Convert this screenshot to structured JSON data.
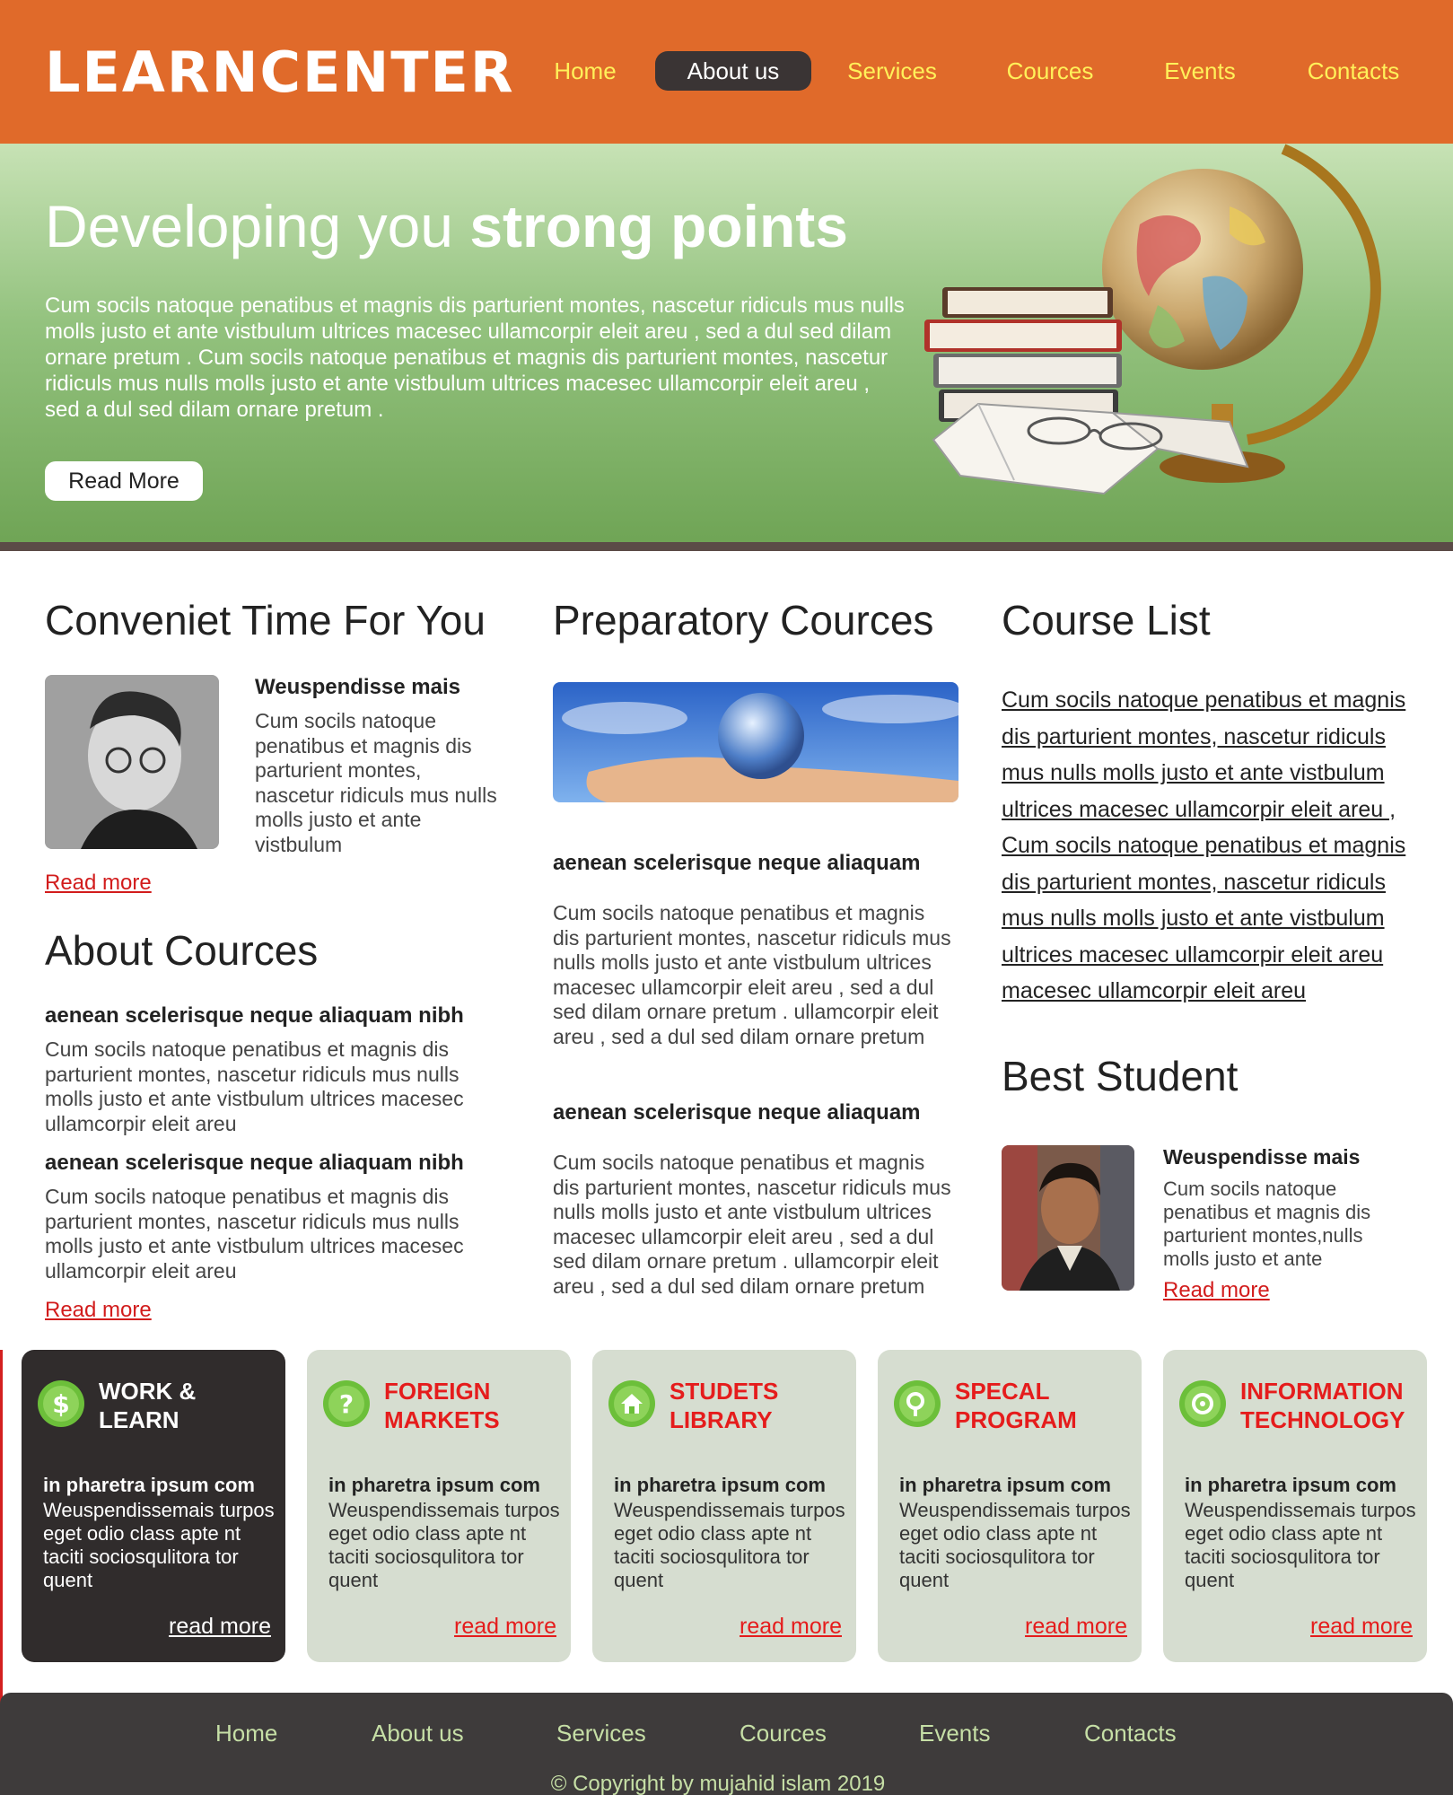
{
  "header": {
    "logo": "LEARNCENTER",
    "nav": [
      {
        "label": "Home"
      },
      {
        "label": "About us"
      },
      {
        "label": "Services"
      },
      {
        "label": "Cources"
      },
      {
        "label": "Events"
      },
      {
        "label": "Contacts"
      }
    ],
    "active_nav": "About us"
  },
  "hero": {
    "title_plain": "Developing you",
    "title_bold": "strong points",
    "text": "Cum socils natoque penatibus et magnis dis parturient montes, nascetur ridiculs mus nulls molls justo et ante vistbulum ultrices macesec ullamcorpir eleit areu , sed a dul sed dilam ornare pretum . Cum socils natoque penatibus et magnis dis parturient montes, nascetur ridiculs mus nulls molls justo et ante vistbulum ultrices macesec ullamcorpir eleit areu , sed a dul sed dilam ornare pretum .",
    "button": "Read More"
  },
  "col1": {
    "title": "Conveniet Time For You",
    "item_title": "Weuspendisse mais",
    "item_text": "Cum socils natoque penatibus et magnis dis parturient montes, nascetur ridiculs mus nulls molls justo et ante vistbulum",
    "read_more": "Read more",
    "about_title": "About Cources",
    "about_items": [
      {
        "title": "aenean scelerisque neque aliaquam nibh",
        "text": "Cum socils natoque penatibus et magnis dis parturient montes, nascetur ridiculs mus nulls molls justo et ante vistbulum ultrices macesec ullamcorpir eleit areu"
      },
      {
        "title": "aenean scelerisque neque aliaquam nibh",
        "text": "Cum socils natoque penatibus et magnis dis parturient montes, nascetur ridiculs mus nulls molls justo et ante vistbulum ultrices macesec ullamcorpir eleit areu"
      }
    ],
    "about_read_more": "Read more"
  },
  "col2": {
    "title": "Preparatory Cources",
    "items": [
      {
        "title": "aenean scelerisque neque aliaquam",
        "text": "Cum socils natoque penatibus et magnis dis parturient montes, nascetur ridiculs mus nulls molls justo et ante vistbulum ultrices macesec ullamcorpir eleit areu , sed a dul sed dilam ornare pretum . ullamcorpir eleit areu , sed a dul sed dilam ornare pretum"
      },
      {
        "title": "aenean scelerisque neque aliaquam",
        "text": "Cum socils natoque penatibus et magnis dis parturient montes, nascetur ridiculs mus nulls molls justo et ante vistbulum ultrices macesec ullamcorpir eleit areu , sed a dul sed dilam ornare pretum . ullamcorpir eleit areu , sed a dul sed dilam ornare pretum"
      }
    ]
  },
  "col3": {
    "title": "Course List",
    "list_lines": [
      "Cum socils natoque penatibus et magnis",
      "dis parturient montes, nascetur ridiculs",
      "mus nulls molls justo et ante vistbulum",
      "ultrices macesec ullamcorpir eleit areu ,",
      "Cum socils natoque penatibus et magnis",
      "dis parturient montes, nascetur ridiculs",
      "mus nulls molls justo et ante vistbulum",
      "ultrices macesec ullamcorpir eleit areu",
      "macesec ullamcorpir eleit areu"
    ],
    "best_title": "Best Student",
    "best_name": "Weuspendisse mais",
    "best_text": "Cum socils natoque penatibus et magnis dis parturient montes,nulls molls justo et ante",
    "best_read_more": "Read more"
  },
  "features": [
    {
      "title_line1": "WORK &",
      "title_line2": "LEARN",
      "icon": "dollar-icon",
      "sub": "in pharetra ipsum com",
      "text": "Weuspendissemais turpos eget odio class apte nt taciti sociosqulitora tor quent",
      "more": "read more"
    },
    {
      "title_line1": "FOREIGN",
      "title_line2": "MARKETS",
      "icon": "question-icon",
      "sub": "in pharetra ipsum com",
      "text": "Weuspendissemais turpos eget odio class apte nt taciti sociosqulitora tor quent",
      "more": "read more"
    },
    {
      "title_line1": "STUDETS",
      "title_line2": "LIBRARY",
      "icon": "home-icon",
      "sub": "in pharetra ipsum com",
      "text": "Weuspendissemais turpos eget odio class apte nt taciti sociosqulitora tor quent",
      "more": "read more"
    },
    {
      "title_line1": "SPECAL",
      "title_line2": "PROGRAM",
      "icon": "search-icon",
      "sub": "in pharetra ipsum com",
      "text": "Weuspendissemais turpos eget odio class apte nt taciti sociosqulitora tor quent",
      "more": "read more"
    },
    {
      "title_line1": "INFORMATION",
      "title_line2": "TECHNOLOGY",
      "icon": "target-icon",
      "sub": "in pharetra ipsum com",
      "text": "Weuspendissemais turpos eget odio class apte nt taciti sociosqulitora tor quent",
      "more": "read more"
    }
  ],
  "footer": {
    "nav": [
      "Home",
      "About us",
      "Services",
      "Cources",
      "Events",
      "Contacts"
    ],
    "copyright": "© Copyright by mujahid islam 2019"
  },
  "colors": {
    "header_orange": "#e06a2a",
    "nav_yellow": "#fff15a",
    "accent_red": "#e51c1c",
    "box_green": "#d6ddd0",
    "footer_dark": "#3e3b3b",
    "footer_text": "#c6dfa6"
  }
}
